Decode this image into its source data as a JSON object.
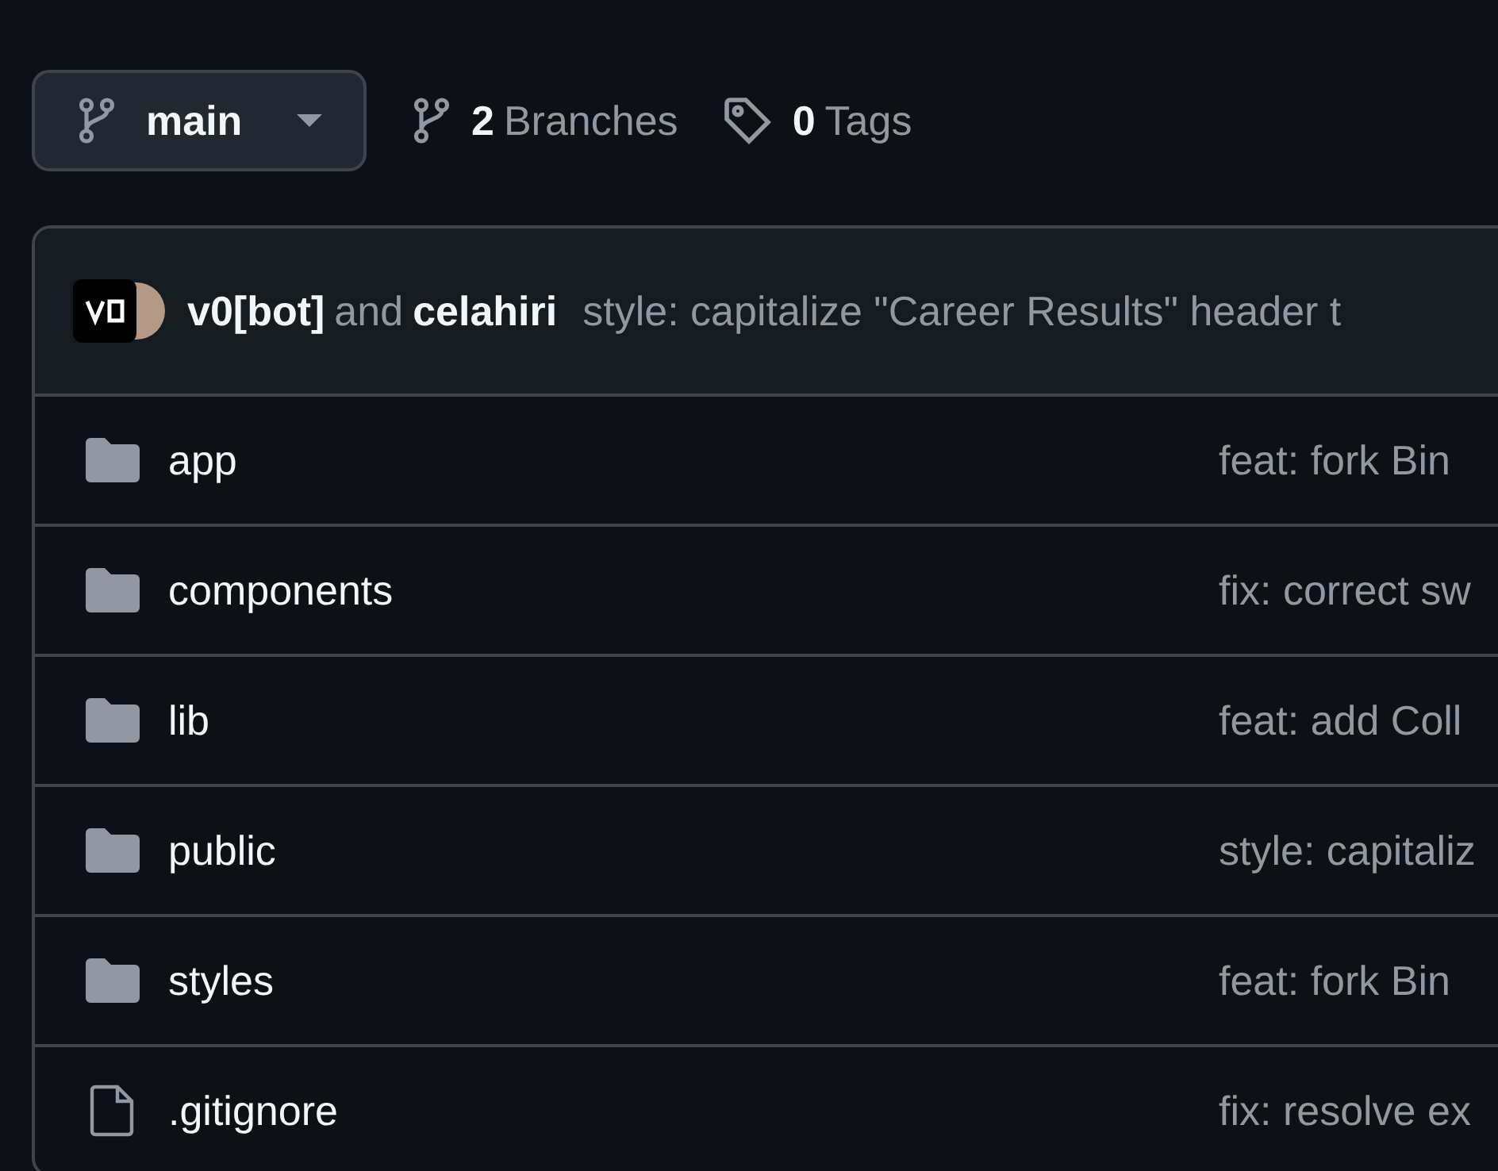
{
  "branch_selector": {
    "label": "main"
  },
  "branches": {
    "count": "2",
    "label": "Branches"
  },
  "tags": {
    "count": "0",
    "label": "Tags"
  },
  "latest_commit": {
    "authors": [
      {
        "name": "v0[bot]"
      },
      {
        "name": "celahiri"
      }
    ],
    "joiner": "and",
    "message": "style: capitalize \"Career Results\" header t"
  },
  "files": [
    {
      "kind": "folder",
      "name": "app",
      "message": "feat: fork Bin"
    },
    {
      "kind": "folder",
      "name": "components",
      "message": "fix: correct sw"
    },
    {
      "kind": "folder",
      "name": "lib",
      "message": "feat: add Coll"
    },
    {
      "kind": "folder",
      "name": "public",
      "message": "style: capitaliz"
    },
    {
      "kind": "folder",
      "name": "styles",
      "message": "feat: fork Bin"
    },
    {
      "kind": "file",
      "name": ".gitignore",
      "message": "fix: resolve ex"
    }
  ]
}
